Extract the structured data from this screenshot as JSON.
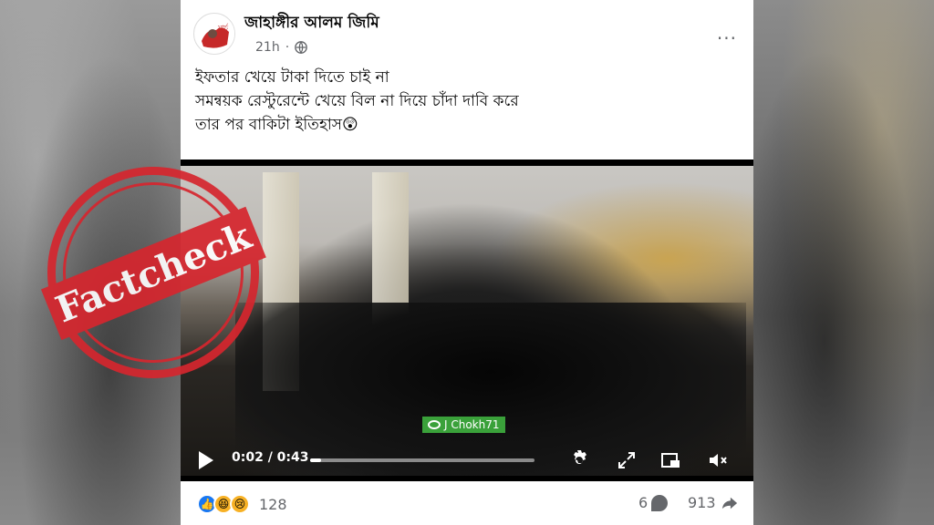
{
  "post": {
    "author": "জাহাঙ্গীর আলম জিমি",
    "avatar_text": "মার্চ",
    "time": "21h",
    "more": "···",
    "caption_lines": [
      "ইফতার খেয়ে টাকা দিতে চাই না",
      "সমন্বয়ক রেস্টুরেন্টে খেয়ে বিল না দিয়ে চাঁদা দাবি করে",
      "তার পর বাকিটা ইতিহাস😲"
    ]
  },
  "video": {
    "watermark": "J Chokh71",
    "time": "0:02 / 0:43",
    "progress": 0.05
  },
  "footer": {
    "reaction_count": "128",
    "comment_count": "6",
    "share_count": "913"
  },
  "stamp": {
    "text": "Factcheck",
    "color": "#d6262e"
  },
  "colors": {
    "facebook_blue": "#1877f2",
    "meta_gray": "#65676b"
  }
}
